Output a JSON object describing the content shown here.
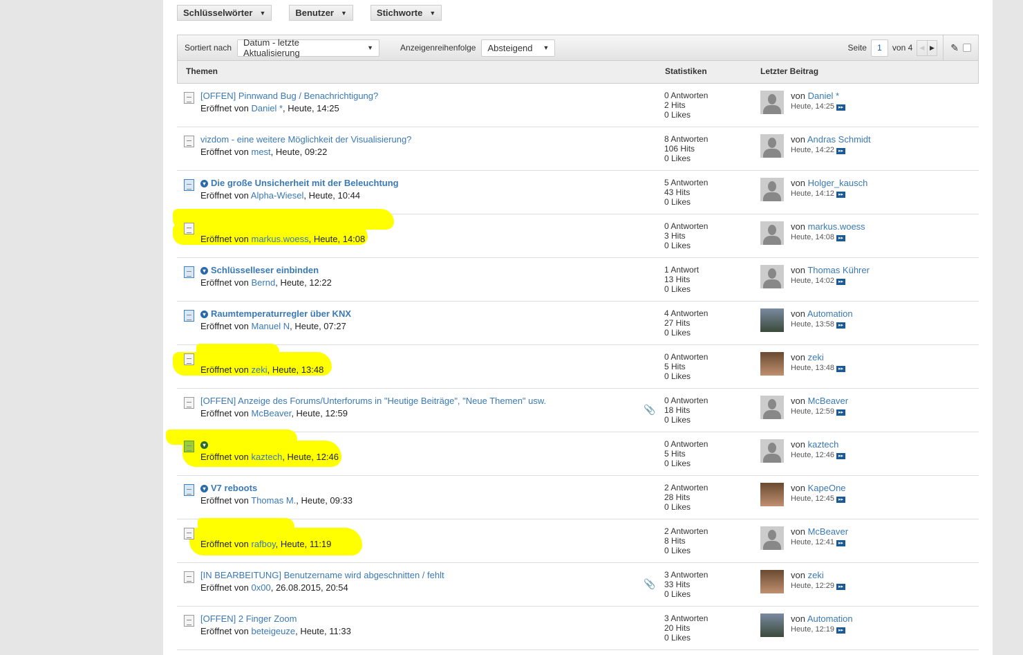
{
  "filters": [
    "Schlüsselwörter",
    "Benutzer",
    "Stichworte"
  ],
  "toolbar": {
    "sort_label": "Sortiert nach",
    "sort_value": "Datum - letzte Aktualisierung",
    "order_label": "Anzeigenreihenfolge",
    "order_value": "Absteigend",
    "page_label": "Seite",
    "page_value": "1",
    "page_of": "von 4"
  },
  "columns": {
    "topics": "Themen",
    "stats": "Statistiken",
    "last": "Letzter Beitrag"
  },
  "opened_by": "Eröffnet von",
  "by": "von",
  "rows": [
    {
      "title": "[OFFEN] Pinnwand Bug / Benachrichtigung?",
      "bold": false,
      "icon": "gray",
      "author": "Daniel *",
      "date": "Heute, 14:25",
      "replies": "0 Antworten",
      "hits": "2 Hits",
      "likes": "0 Likes",
      "last_user": "Daniel *",
      "last_date": "Heute, 14:25",
      "avatar": "default"
    },
    {
      "title": "vizdom - eine weitere Möglichkeit der Visualisierung?",
      "bold": false,
      "icon": "gray",
      "author": "mest",
      "date": "Heute, 09:22",
      "replies": "8 Antworten",
      "hits": "106 Hits",
      "likes": "0 Likes",
      "last_user": "Andras Schmidt",
      "last_date": "Heute, 14:22",
      "avatar": "default"
    },
    {
      "title": "Die große Unsicherheit mit der Beleuchtung",
      "bold": true,
      "icon": "blue",
      "author": "Alpha-Wiesel",
      "date": "Heute, 10:44",
      "replies": "5 Antworten",
      "hits": "43 Hits",
      "likes": "0 Likes",
      "last_user": "Holger_kausch",
      "last_date": "Heute, 14:12",
      "avatar": "default"
    },
    {
      "title": "",
      "bold": false,
      "icon": "gray",
      "hl": true,
      "author": "markus.woess",
      "date": "Heute, 14:08",
      "replies": "0 Antworten",
      "hits": "3 Hits",
      "likes": "0 Likes",
      "last_user": "markus.woess",
      "last_date": "Heute, 14:08",
      "avatar": "default"
    },
    {
      "title": "Schlüsselleser einbinden",
      "bold": true,
      "icon": "blue",
      "author": "Bernd",
      "date": "Heute, 12:22",
      "replies": "1 Antwort",
      "hits": "13 Hits",
      "likes": "0 Likes",
      "last_user": "Thomas Kührer",
      "last_date": "Heute, 14:02",
      "avatar": "default"
    },
    {
      "title": "Raumtemperaturregler über KNX",
      "bold": true,
      "icon": "blue",
      "author": "Manuel N",
      "date": "Heute, 07:27",
      "replies": "4 Antworten",
      "hits": "27 Hits",
      "likes": "0 Likes",
      "last_user": "Automation",
      "last_date": "Heute, 13:58",
      "avatar": "photo"
    },
    {
      "title": "",
      "bold": false,
      "icon": "gray",
      "hl": true,
      "author": "zeki",
      "date": "Heute, 13:48",
      "replies": "0 Antworten",
      "hits": "5 Hits",
      "likes": "0 Likes",
      "last_user": "zeki",
      "last_date": "Heute, 13:48",
      "avatar": "face"
    },
    {
      "title": "[OFFEN] Anzeige des Forums/Unterforums in \"Heutige Beiträge\", \"Neue Themen\" usw.",
      "bold": false,
      "icon": "gray",
      "clip": true,
      "author": "McBeaver",
      "date": "Heute, 12:59",
      "replies": "0 Antworten",
      "hits": "18 Hits",
      "likes": "0 Likes",
      "last_user": "McBeaver",
      "last_date": "Heute, 12:59",
      "avatar": "default"
    },
    {
      "title": "",
      "bold": true,
      "icon": "green",
      "hl": true,
      "author": "kaztech",
      "date": "Heute, 12:46",
      "replies": "0 Antworten",
      "hits": "5 Hits",
      "likes": "0 Likes",
      "last_user": "kaztech",
      "last_date": "Heute, 12:46",
      "avatar": "default"
    },
    {
      "title": "V7 reboots",
      "bold": true,
      "icon": "blue",
      "author": "Thomas M.",
      "date": "Heute, 09:33",
      "replies": "2 Antworten",
      "hits": "28 Hits",
      "likes": "0 Likes",
      "last_user": "KapeOne",
      "last_date": "Heute, 12:45",
      "avatar": "face"
    },
    {
      "title": "",
      "bold": false,
      "icon": "gray",
      "hl": true,
      "author": "rafboy",
      "date": "Heute, 11:19",
      "replies": "2 Antworten",
      "hits": "8 Hits",
      "likes": "0 Likes",
      "last_user": "McBeaver",
      "last_date": "Heute, 12:41",
      "avatar": "default"
    },
    {
      "title": "[IN BEARBEITUNG] Benutzername wird abgeschnitten / fehlt",
      "bold": false,
      "icon": "gray",
      "clip": true,
      "author": "0x00",
      "date": "26.08.2015, 20:54",
      "replies": "3 Antworten",
      "hits": "33 Hits",
      "likes": "0 Likes",
      "last_user": "zeki",
      "last_date": "Heute, 12:29",
      "avatar": "face"
    },
    {
      "title": "[OFFEN] 2 Finger Zoom",
      "bold": false,
      "icon": "gray",
      "author": "beteigeuze",
      "date": "Heute, 11:33",
      "replies": "3 Antworten",
      "hits": "20 Hits",
      "likes": "0 Likes",
      "last_user": "Automation",
      "last_date": "Heute, 12:19",
      "avatar": "photo"
    }
  ]
}
